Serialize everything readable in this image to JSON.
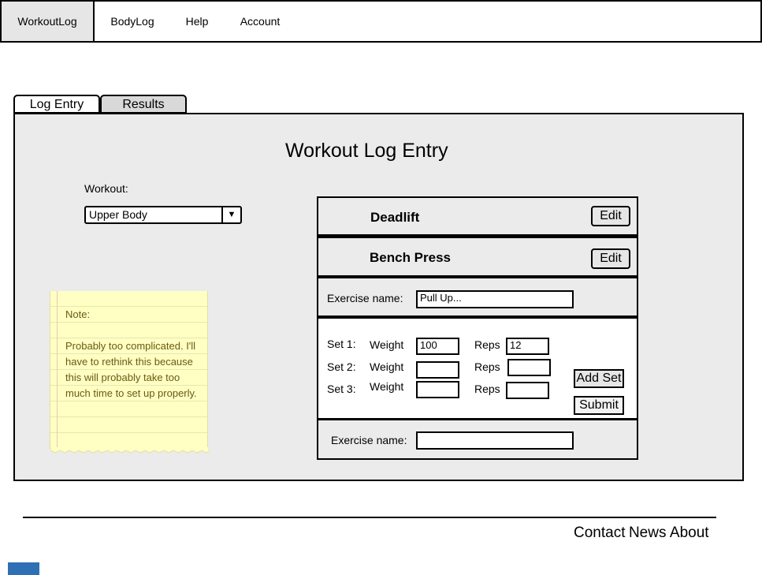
{
  "nav": {
    "items": [
      {
        "label": "WorkoutLog",
        "active": true
      },
      {
        "label": "BodyLog"
      },
      {
        "label": "Help"
      },
      {
        "label": "Account"
      }
    ]
  },
  "tabs": [
    {
      "label": "Log Entry",
      "active": true
    },
    {
      "label": "Results"
    }
  ],
  "page": {
    "title": "Workout Log Entry",
    "workout_label": "Workout:",
    "workout_select_value": "Upper Body"
  },
  "exercises": [
    {
      "name": "Deadlift",
      "edit_label": "Edit"
    },
    {
      "name": "Bench Press",
      "edit_label": "Edit"
    }
  ],
  "current_exercise": {
    "name_label": "Exercise name:",
    "name_value": "Pull Up...",
    "sets": [
      {
        "set_label": "Set 1:",
        "weight_label": "Weight",
        "weight_value": "100",
        "reps_label": "Reps",
        "reps_value": "12"
      },
      {
        "set_label": "Set 2:",
        "weight_label": "Weight",
        "weight_value": "",
        "reps_label": "Reps",
        "reps_value": ""
      },
      {
        "set_label": "Set 3:",
        "weight_label": "Weight",
        "weight_value": "",
        "reps_label": "Reps",
        "reps_value": ""
      }
    ],
    "add_set_label": "Add Set",
    "submit_label": "Submit"
  },
  "new_exercise": {
    "name_label": "Exercise name:",
    "name_value": ""
  },
  "note": {
    "heading": "Note:",
    "body": "Probably too complicated. I'll have to rethink this because this will probably take too much time to set up properly."
  },
  "footer": {
    "links": [
      "Contact",
      "News",
      "About"
    ]
  },
  "colors": {
    "panel_bg": "#ebebeb",
    "note_bg": "#ffffc4",
    "active_nav_bg": "#e6e6e6"
  }
}
